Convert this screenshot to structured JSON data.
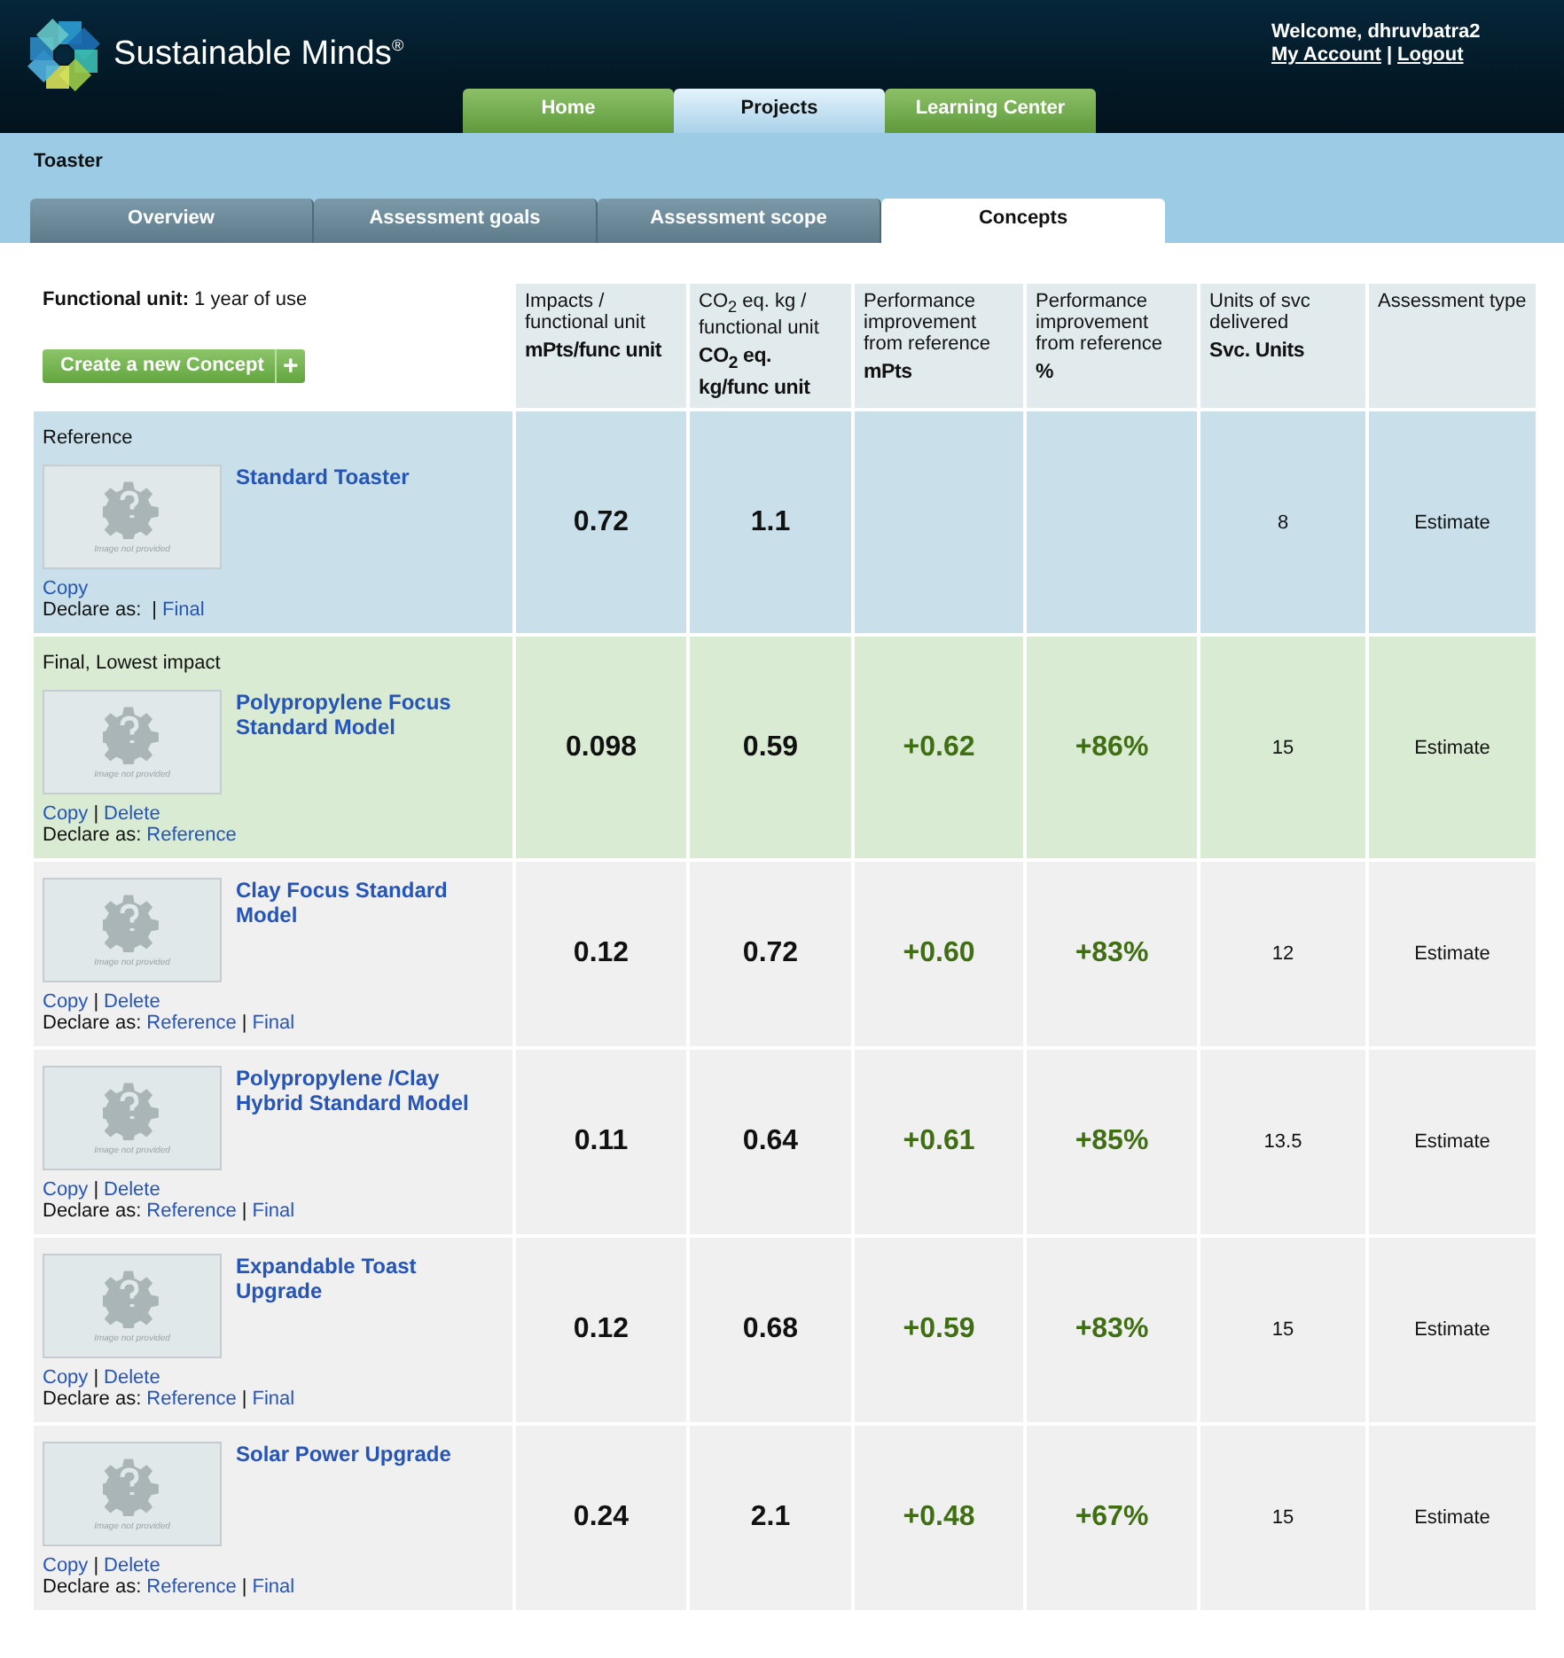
{
  "brand": {
    "name": "Sustainable Minds$^{®}$"
  },
  "user": {
    "welcome": "Welcome, dhruvbatra2",
    "links": [
      {
        "kind": "link",
        "text": "My Account"
      },
      {
        "kind": "sep",
        "text": "|"
      },
      {
        "kind": "link",
        "text": "Logout"
      }
    ]
  },
  "nav_tabs": [
    {
      "label": "Home",
      "selected": false
    },
    {
      "label": "Projects",
      "selected": true
    },
    {
      "label": "Learning Center",
      "selected": false
    }
  ],
  "project": {
    "title": "Toaster"
  },
  "sub_tabs": [
    {
      "label": "Overview",
      "selected": false
    },
    {
      "label": "Assessment goals",
      "selected": false
    },
    {
      "label": "Assessment scope",
      "selected": false
    },
    {
      "label": "Concepts",
      "selected": true
    }
  ],
  "functional_unit": {
    "label": "Functional unit:",
    "value": "1 year of use"
  },
  "create_button": {
    "label": "Create a new Concept",
    "icon": "+"
  },
  "columns": [
    {
      "title": "Impacts / functional unit",
      "unit": "mPts/func unit"
    },
    {
      "title": "CO$_{2}$ eq. kg / functional unit",
      "unit": "CO$_{2}$ eq. kg/func unit"
    },
    {
      "title": "Performance improvement from reference",
      "unit": "mPts"
    },
    {
      "title": "Performance improvement from reference",
      "unit": "%"
    },
    {
      "title": "Units of svc delivered",
      "unit": "Svc. Units"
    },
    {
      "title": "Assessment type"
    }
  ],
  "concepts": [
    {
      "kind": "reference",
      "status_label": "Reference",
      "name": "Standard Toaster",
      "image_text": "Image not provided",
      "actions": [
        {
          "kind": "link",
          "text": "Copy"
        }
      ],
      "declare_label": "Declare as:",
      "declare": [
        {
          "kind": "sep",
          "text": "|"
        },
        {
          "kind": "link",
          "text": "Final"
        }
      ],
      "impact": "0.72",
      "co2": "1.1",
      "units": "8",
      "assessment": "Estimate"
    },
    {
      "kind": "final",
      "status_label": "Final, Lowest impact",
      "name": "Polypropylene Focus Standard Model",
      "image_text": "Image not provided",
      "actions": [
        {
          "kind": "link",
          "text": "Copy"
        },
        {
          "kind": "sep",
          "text": "|"
        },
        {
          "kind": "link",
          "text": "Delete"
        }
      ],
      "declare_label": "Declare as:",
      "declare": [
        {
          "kind": "link",
          "text": "Reference"
        }
      ],
      "impact": "0.098",
      "co2": "0.59",
      "improvement_mpts": "+0.62",
      "improvement_pct": "+86%",
      "units": "15",
      "assessment": "Estimate"
    },
    {
      "kind": "normal",
      "name": "Clay Focus Standard Model",
      "image_text": "Image not provided",
      "actions": [
        {
          "kind": "link",
          "text": "Copy"
        },
        {
          "kind": "sep",
          "text": "|"
        },
        {
          "kind": "link",
          "text": "Delete"
        }
      ],
      "declare_label": "Declare as:",
      "declare": [
        {
          "kind": "link",
          "text": "Reference"
        },
        {
          "kind": "sep",
          "text": "|"
        },
        {
          "kind": "link",
          "text": "Final"
        }
      ],
      "impact": "0.12",
      "co2": "0.72",
      "improvement_mpts": "+0.60",
      "improvement_pct": "+83%",
      "units": "12",
      "assessment": "Estimate"
    },
    {
      "kind": "normal",
      "name": "Polypropylene /Clay Hybrid Standard Model",
      "image_text": "Image not provided",
      "actions": [
        {
          "kind": "link",
          "text": "Copy"
        },
        {
          "kind": "sep",
          "text": "|"
        },
        {
          "kind": "link",
          "text": "Delete"
        }
      ],
      "declare_label": "Declare as:",
      "declare": [
        {
          "kind": "link",
          "text": "Reference"
        },
        {
          "kind": "sep",
          "text": "|"
        },
        {
          "kind": "link",
          "text": "Final"
        }
      ],
      "impact": "0.11",
      "co2": "0.64",
      "improvement_mpts": "+0.61",
      "improvement_pct": "+85%",
      "units": "13.5",
      "assessment": "Estimate"
    },
    {
      "kind": "normal",
      "name": "Expandable Toast Upgrade",
      "image_text": "Image not provided",
      "actions": [
        {
          "kind": "link",
          "text": "Copy"
        },
        {
          "kind": "sep",
          "text": "|"
        },
        {
          "kind": "link",
          "text": "Delete"
        }
      ],
      "declare_label": "Declare as:",
      "declare": [
        {
          "kind": "link",
          "text": "Reference"
        },
        {
          "kind": "sep",
          "text": "|"
        },
        {
          "kind": "link",
          "text": "Final"
        }
      ],
      "impact": "0.12",
      "co2": "0.68",
      "improvement_mpts": "+0.59",
      "improvement_pct": "+83%",
      "units": "15",
      "assessment": "Estimate"
    },
    {
      "kind": "normal",
      "name": "Solar Power Upgrade",
      "image_text": "Image not provided",
      "actions": [
        {
          "kind": "link",
          "text": "Copy"
        },
        {
          "kind": "sep",
          "text": "|"
        },
        {
          "kind": "link",
          "text": "Delete"
        }
      ],
      "declare_label": "Declare as:",
      "declare": [
        {
          "kind": "link",
          "text": "Reference"
        },
        {
          "kind": "sep",
          "text": "|"
        },
        {
          "kind": "link",
          "text": "Final"
        }
      ],
      "impact": "0.24",
      "co2": "2.1",
      "improvement_mpts": "+0.48",
      "improvement_pct": "+67%",
      "units": "15",
      "assessment": "Estimate"
    }
  ]
}
